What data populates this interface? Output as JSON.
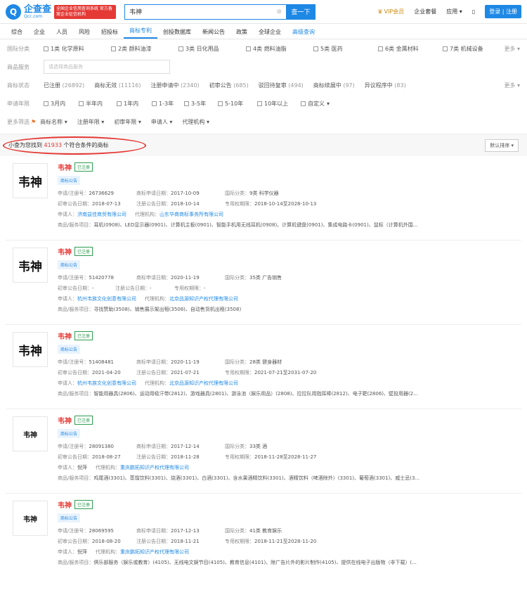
{
  "header": {
    "logo_char": "Q",
    "logo_name": "企查查",
    "logo_domain": "Qcc.com",
    "badge": "全国企业信用查询系统 官方备案企业征信机构",
    "search_value": "韦神",
    "search_button": "查一下",
    "vip": "VIP会员",
    "enterprise": "企业套餐",
    "apps": "应用",
    "login": "登录 | 注册"
  },
  "nav": [
    "综合",
    "企业",
    "人员",
    "风险",
    "招投标",
    "商标专利",
    "创投数据库",
    "新闻公告",
    "政策",
    "全球企业",
    "高级查询"
  ],
  "filters": {
    "class_label": "国际分类",
    "classes": [
      "1类 化学原料",
      "2类 颜料油漆",
      "3类 日化用品",
      "4类 燃料油脂",
      "5类 医药",
      "6类 金属材料",
      "7类 机械设备"
    ],
    "more": "更多",
    "service_label": "商品服务",
    "service_placeholder": "请选择商品服务",
    "status_label": "商标状态",
    "statuses": [
      {
        "label": "已注册",
        "count": "(26892)"
      },
      {
        "label": "商标无效",
        "count": "(11116)"
      },
      {
        "label": "注册申请中",
        "count": "(2340)"
      },
      {
        "label": "初审公告",
        "count": "(685)"
      },
      {
        "label": "驳回待复审",
        "count": "(494)"
      },
      {
        "label": "商标续展中",
        "count": "(97)"
      },
      {
        "label": "异议程序中",
        "count": "(83)"
      }
    ],
    "year_label": "申请年限",
    "years": [
      "3月内",
      "半年内",
      "1年内",
      "1-3年",
      "3-5年",
      "5-10年",
      "10年以上",
      "自定义"
    ],
    "more_label": "更多筛选",
    "more_filters": [
      "商标名称",
      "注册年限",
      "初审年限",
      "申请人",
      "代理机构"
    ]
  },
  "summary": {
    "prefix": "小查为您找到",
    "count": "41933",
    "suffix": "个符合条件的商标",
    "sort": "默认排序"
  },
  "results": [
    {
      "name": "韦神",
      "status": "已注册",
      "tag": "商标公告",
      "thumb": "韦神",
      "reg_no": "26736629",
      "apply_date": "2017-10-09",
      "class": "9类 科学仪器",
      "prelim_date": "2018-07-13",
      "reg_date": "2018-10-14",
      "period": "2018-10-14至2028-10-13",
      "applicant": "济南益佳商贸有限公司",
      "agent": "山东华商商标事务所有限公司",
      "goods": "耳机(0908)、LED显示器(0901)、计算机主板(0901)、智能手机用无线耳机(0908)、计算机键盘(0901)、集成电路卡(0901)、鼠标（计算机外围..."
    },
    {
      "name": "韦神",
      "status": "已注册",
      "tag": "商标公告",
      "thumb": "韦神",
      "reg_no": "51420778",
      "apply_date": "2020-11-19",
      "class": "35类 广告销售",
      "prelim_date": "-",
      "reg_date": "-",
      "period": "-",
      "applicant": "杭州韦族文化创意有限公司",
      "agent": "北京品源知识产权代理有限公司",
      "goods": "寻找赞助(3508)、销售展示架出租(3508)、自动售货机出租(3508)"
    },
    {
      "name": "韦神",
      "status": "已注册",
      "tag": "商标公告",
      "thumb": "韦神",
      "reg_no": "51408481",
      "apply_date": "2020-11-19",
      "class": "28类 健身器材",
      "prelim_date": "2021-04-20",
      "reg_date": "2021-07-21",
      "period": "2021-07-21至2031-07-20",
      "applicant": "杭州韦族文化创意有限公司",
      "agent": "北京品源知识产权代理有限公司",
      "goods": "智能用器具(2806)、运动用吸汗带(2812)、游戏器具(2801)、游泳池（娱乐用品）(2808)、拉拉队用指挥棒(2812)、电子靶(2806)、壁投用器(2..."
    },
    {
      "name": "韦神",
      "status": "已注册",
      "tag": "商标公告",
      "thumb": "韦神",
      "reg_no": "28091380",
      "apply_date": "2017-12-14",
      "class": "33类 酒",
      "prelim_date": "2018-08-27",
      "reg_date": "2018-11-28",
      "period": "2018-11-28至2028-11-27",
      "applicant": "倪萍",
      "agent": "重庆鹏拓知识产权代理有限公司",
      "goods": "鸡尾酒(3301)、蒸馏饮料(3301)、烧酒(3301)、白酒(3301)、含水果酒精饮料(3301)、酒精饮料（啤酒除外）(3301)、葡萄酒(3301)、威士忌(3..."
    },
    {
      "name": "韦神",
      "status": "已注册",
      "tag": "商标公告",
      "thumb": "韦神",
      "reg_no": "28069595",
      "apply_date": "2017-12-13",
      "class": "41类 教育娱乐",
      "prelim_date": "2018-08-20",
      "reg_date": "2018-11-21",
      "period": "2018-11-21至2028-11-20",
      "applicant": "倪萍",
      "agent": "重庆鹏拓知识产权代理有限公司",
      "goods": "俱乐部服务（娱乐或教育）(4105)、无线电文娱节目(4105)、教育信息(4101)、除广告片外的影片制作(4105)、提供在线电子出版物（非下载）(..."
    }
  ],
  "labels": {
    "reg_no": "申请/注册号：",
    "apply_date": "商标申请日期：",
    "class": "国际分类：",
    "prelim_date": "初审公告日期：",
    "reg_date": "注册公告日期：",
    "period": "专用权期限：",
    "applicant": "申请人：",
    "agent": "代理机构：",
    "goods": "商品/服务项目："
  }
}
